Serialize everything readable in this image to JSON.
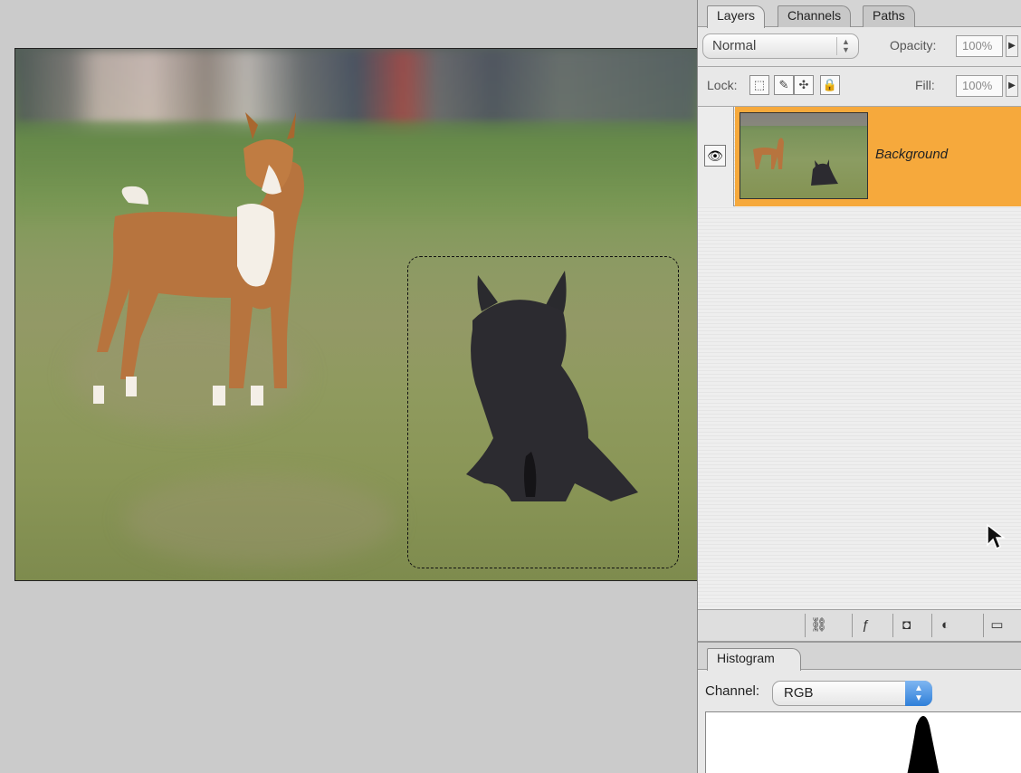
{
  "layers_panel": {
    "tabs": [
      "Layers",
      "Channels",
      "Paths"
    ],
    "blend_mode": "Normal",
    "opacity_label": "Opacity:",
    "opacity_value": "100%",
    "lock_label": "Lock:",
    "fill_label": "Fill:",
    "fill_value": "100%",
    "layers": [
      {
        "name": "Background",
        "visible": true,
        "selected": true
      }
    ]
  },
  "histogram_panel": {
    "tab": "Histogram",
    "channel_label": "Channel:",
    "channel_value": "RGB"
  },
  "colors": {
    "selected_layer": "#f6a93c",
    "panel_bg": "#e8e8e8",
    "workspace_bg": "#cbcbcb"
  }
}
